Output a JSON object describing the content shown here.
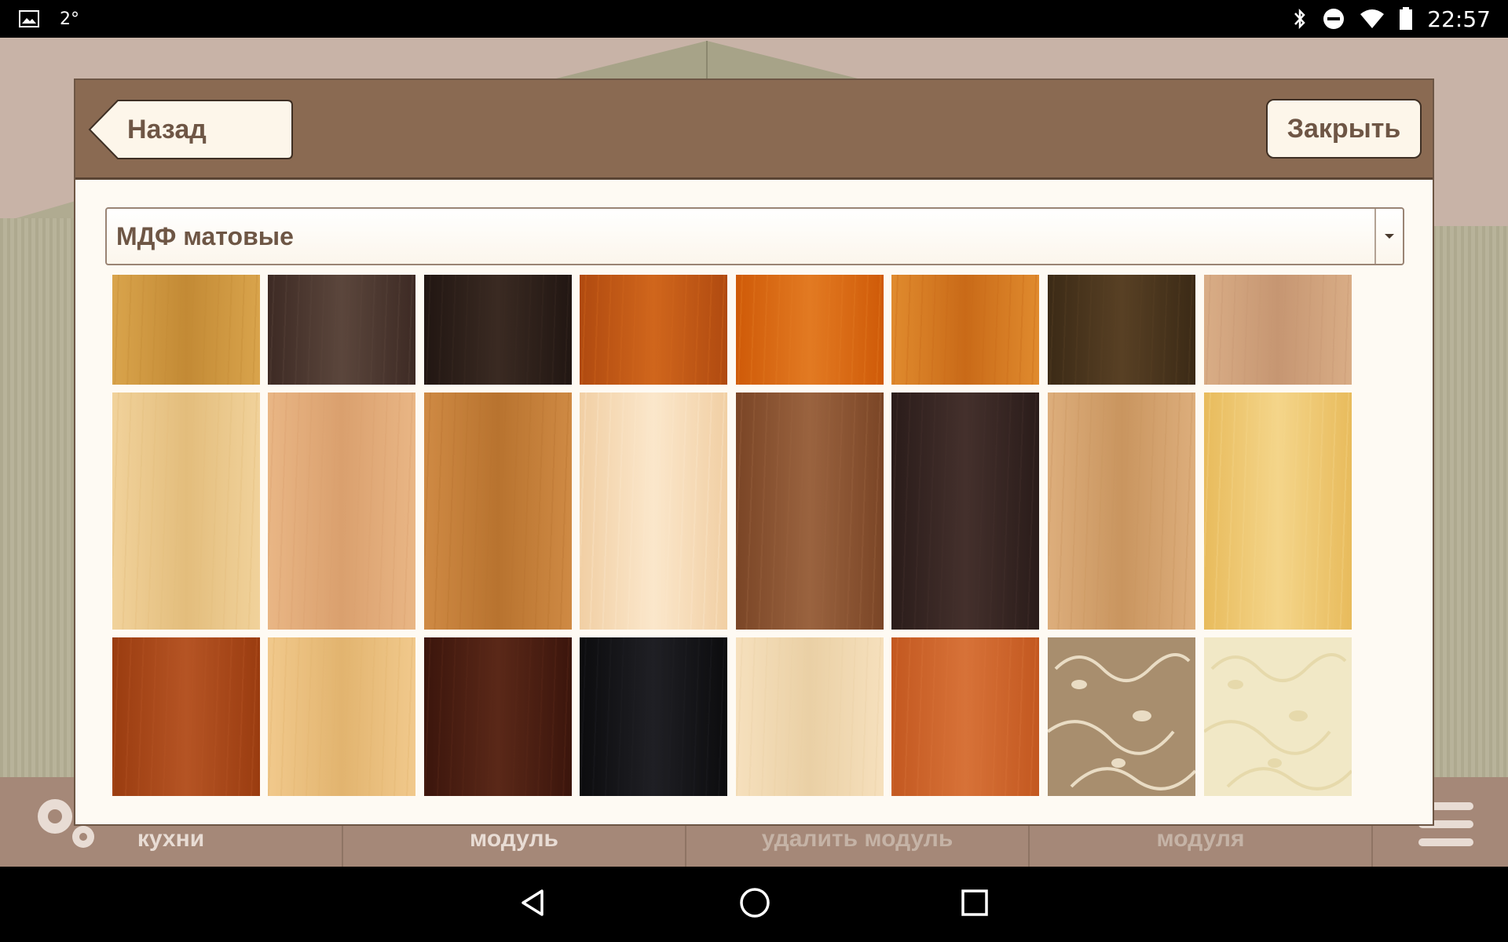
{
  "status_bar": {
    "temperature": "2°",
    "time": "22:57",
    "icons": [
      "image-icon",
      "bluetooth-icon",
      "do-not-disturb-icon",
      "wifi-icon",
      "battery-icon"
    ]
  },
  "dialog": {
    "back_label": "Назад",
    "close_label": "Закрыть",
    "category": {
      "selected": "МДФ матовые"
    },
    "swatches": [
      {
        "color": "#d9a44c",
        "grain": "#c38a35"
      },
      {
        "color": "#3d2a24",
        "grain": "#5b463c"
      },
      {
        "color": "#211612",
        "grain": "#3a2a22"
      },
      {
        "color": "#b04a10",
        "grain": "#d0661c"
      },
      {
        "color": "#cf5a08",
        "grain": "#e27a22"
      },
      {
        "color": "#e08b2e",
        "grain": "#c96a18"
      },
      {
        "color": "#3b2a16",
        "grain": "#584024"
      },
      {
        "color": "#d9ad86",
        "grain": "#c69672"
      },
      {
        "color": "#f1d29b",
        "grain": "#e3bd7c"
      },
      {
        "color": "#e9b685",
        "grain": "#daa06e"
      },
      {
        "color": "#cf8a44",
        "grain": "#b8732f"
      },
      {
        "color": "#f1cfa4",
        "grain": "#fbe7cb"
      },
      {
        "color": "#7a4526",
        "grain": "#9a633f"
      },
      {
        "color": "#2a1c1a",
        "grain": "#44302c"
      },
      {
        "color": "#ddae7c",
        "grain": "#c9955f"
      },
      {
        "color": "#e8bb5c",
        "grain": "#f4d58a"
      },
      {
        "color": "#9a3c10",
        "grain": "#b55424"
      },
      {
        "color": "#f1c98c",
        "grain": "#e2b46f"
      },
      {
        "color": "#3b150c",
        "grain": "#5a2818"
      },
      {
        "color": "#0c0c0e",
        "grain": "#1f1f24"
      },
      {
        "color": "#f6e0bd",
        "grain": "#ead0a5"
      },
      {
        "color": "#c35820",
        "grain": "#d77238"
      },
      {
        "color": "#a88e6e",
        "grain": "#e9dcc4",
        "pattern": "floral"
      },
      {
        "color": "#f1e8c6",
        "grain": "#e6d9ab",
        "pattern": "floral"
      }
    ]
  },
  "toolbar": {
    "items": [
      {
        "label": "кухни",
        "faded": false
      },
      {
        "label": "модуль",
        "faded": false
      },
      {
        "label": "удалить модуль",
        "faded": true
      },
      {
        "label": "модуля",
        "faded": true
      }
    ]
  },
  "nav": {
    "icons": [
      "back-icon",
      "home-icon",
      "recents-icon"
    ]
  }
}
